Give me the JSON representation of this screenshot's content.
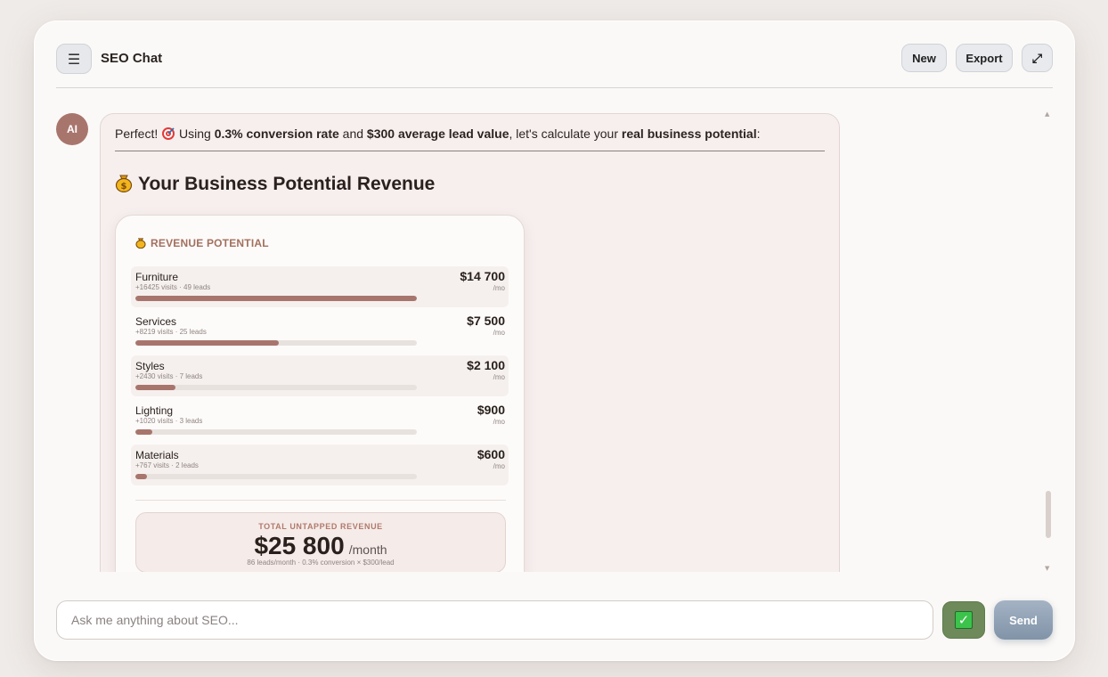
{
  "header": {
    "menu_icon": "☰",
    "title": "SEO Chat",
    "new_label": "New",
    "export_label": "Export",
    "expand_icon": "⤢"
  },
  "message": {
    "avatar_text": "AI",
    "intro_before": "Perfect! ",
    "intro_using": " Using ",
    "intro_rate": "0.3% conversion rate",
    "intro_and": " and ",
    "intro_value": "$300 average lead value",
    "intro_mid": ", let's calculate your ",
    "intro_potential": "real business potential",
    "intro_end": ":",
    "section_title": "Your Business Potential Revenue"
  },
  "revenue_card": {
    "header": "REVENUE POTENTIAL",
    "rows": [
      {
        "name": "Furniture",
        "sub": "+16425 visits · 49 leads",
        "value": "$14 700",
        "per": "/mo",
        "share": 1.0
      },
      {
        "name": "Services",
        "sub": "+8219 visits · 25 leads",
        "value": "$7 500",
        "per": "/mo",
        "share": 0.51
      },
      {
        "name": "Styles",
        "sub": "+2430 visits · 7 leads",
        "value": "$2 100",
        "per": "/mo",
        "share": 0.143
      },
      {
        "name": "Lighting",
        "sub": "+1020 visits · 3 leads",
        "value": "$900",
        "per": "/mo",
        "share": 0.061
      },
      {
        "name": "Materials",
        "sub": "+767 visits · 2 leads",
        "value": "$600",
        "per": "/mo",
        "share": 0.041
      }
    ],
    "total_label": "TOTAL UNTAPPED REVENUE",
    "total_amount": "$25 800",
    "total_unit": "/month",
    "total_note": "86 leads/month · 0.3% conversion × $300/lead"
  },
  "input": {
    "placeholder": "Ask me anything about SEO...",
    "check_icon": "✓",
    "send_label": "Send"
  }
}
